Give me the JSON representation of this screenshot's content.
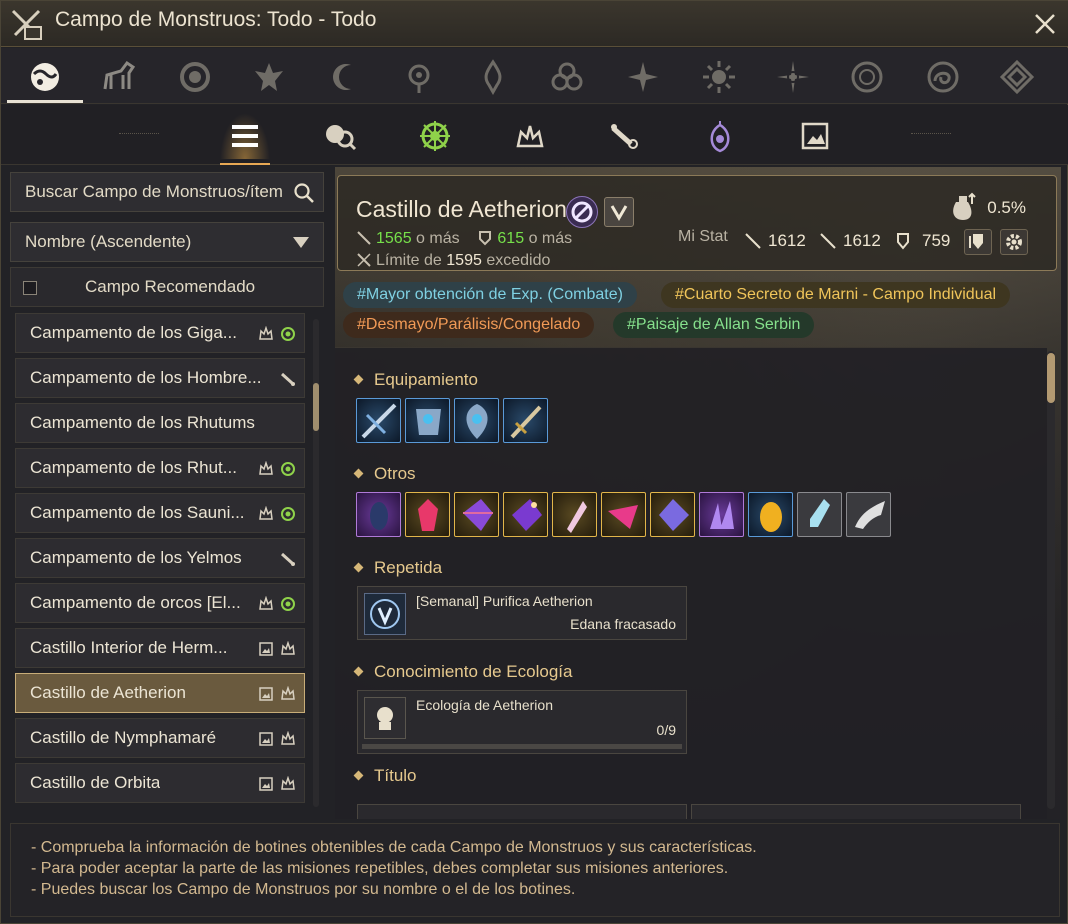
{
  "window": {
    "title": "Campo de Monstruos: Todo - Todo",
    "close_label": "×"
  },
  "category_tabs": [
    {
      "icon": "world-icon",
      "active": true
    },
    {
      "icon": "horse-icon"
    },
    {
      "icon": "lion-icon"
    },
    {
      "icon": "eagle-crest-icon"
    },
    {
      "icon": "crescent-moon-icon"
    },
    {
      "icon": "orb-icon"
    },
    {
      "icon": "flame-crest-icon"
    },
    {
      "icon": "knot-icon"
    },
    {
      "icon": "star-burst-icon"
    },
    {
      "icon": "sun-icon"
    },
    {
      "icon": "compass-star-icon"
    },
    {
      "icon": "circle-sigil-icon"
    },
    {
      "icon": "swirl-icon"
    },
    {
      "icon": "lattice-icon"
    }
  ],
  "filter_tabs": [
    {
      "icon": "list-icon",
      "active": true
    },
    {
      "icon": "search-ecology-icon"
    },
    {
      "icon": "green-emblem-icon"
    },
    {
      "icon": "crown-icon"
    },
    {
      "icon": "scroll-icon"
    },
    {
      "icon": "purple-lantern-icon"
    },
    {
      "icon": "picture-frame-icon"
    }
  ],
  "sidebar": {
    "search_placeholder": "Buscar Campo de Monstruos/ítem",
    "sort_label": "Nombre (Ascendente)",
    "recommended_label": "Campo Recomendado",
    "items": [
      {
        "label": "Campamento de los Giga...",
        "icons": [
          "crown-icon",
          "green-emblem-icon"
        ]
      },
      {
        "label": "Campamento de los Hombre...",
        "icons": [
          "scroll-icon"
        ]
      },
      {
        "label": "Campamento de los Rhutums",
        "icons": []
      },
      {
        "label": "Campamento de los Rhut...",
        "icons": [
          "crown-icon",
          "green-emblem-icon"
        ]
      },
      {
        "label": "Campamento de los Sauni...",
        "icons": [
          "crown-icon",
          "green-emblem-icon"
        ]
      },
      {
        "label": "Campamento de los Yelmos",
        "icons": [
          "scroll-icon"
        ]
      },
      {
        "label": "Campamento de orcos [El...",
        "icons": [
          "crown-icon",
          "green-emblem-icon"
        ]
      },
      {
        "label": "Castillo Interior de Herm...",
        "icons": [
          "picture-frame-icon",
          "crown-icon"
        ]
      },
      {
        "label": "Castillo de Aetherion",
        "icons": [
          "picture-frame-icon",
          "crown-icon"
        ],
        "selected": true
      },
      {
        "label": "Castillo de Nymphamaré",
        "icons": [
          "picture-frame-icon",
          "crown-icon"
        ]
      },
      {
        "label": "Castillo de Orbita",
        "icons": [
          "picture-frame-icon",
          "crown-icon"
        ]
      }
    ]
  },
  "detail": {
    "name": "Castillo de Aetherion",
    "ap_value": "1565",
    "ap_suffix": "o más",
    "dp_value": "615",
    "dp_suffix": "o más",
    "limit_prefix": "Límite de",
    "limit_value": "1595",
    "limit_suffix": "excedido",
    "drop_rate": "0.5%",
    "my_stat_label": "Mi Stat",
    "my_ap": "1612",
    "my_aap": "1612",
    "my_dp": "759",
    "tags": [
      {
        "label": "#Mayor obtención de Exp. (Combate)",
        "color": "#7fd0e2"
      },
      {
        "label": "#Cuarto Secreto de Marni - Campo Individual",
        "color": "#f0c55a"
      },
      {
        "label": "#Desmayo/Parálisis/Congelado",
        "color": "#f19a56"
      },
      {
        "label": "#Paisaje de Allan Serbin",
        "color": "#86e08c"
      }
    ],
    "sections": {
      "equipment": "Equipamiento",
      "others": "Otros",
      "repeat": "Repetida",
      "ecology": "Conocimiento de Ecología",
      "title": "Título"
    },
    "equipment_items": [
      "crossbow-icon",
      "armor-icon",
      "shield-icon",
      "sword-icon"
    ],
    "other_items": [
      "dark-stone-icon",
      "red-crystal-icon",
      "purple-gem-icon",
      "blue-purple-gem-icon",
      "white-crystal-icon",
      "pink-shard-icon",
      "violet-gem-icon",
      "violet-cluster-icon",
      "golden-egg-icon",
      "potion-icon",
      "horn-icon"
    ],
    "repeat_quest": {
      "title": "[Semanal] Purifica Aetherion",
      "status": "Edana fracasado"
    },
    "ecology": {
      "title": "Ecología de Aetherion",
      "progress": "0/9"
    }
  },
  "footer": {
    "lines": [
      "- Comprueba la información de botines obtenibles de cada Campo de Monstruos y sus características.",
      "- Para poder aceptar la parte de las misiones repetibles, debes completar sus misiones anteriores.",
      "- Puedes buscar los Campo de Monstruos por su nombre o el de los botines."
    ]
  }
}
